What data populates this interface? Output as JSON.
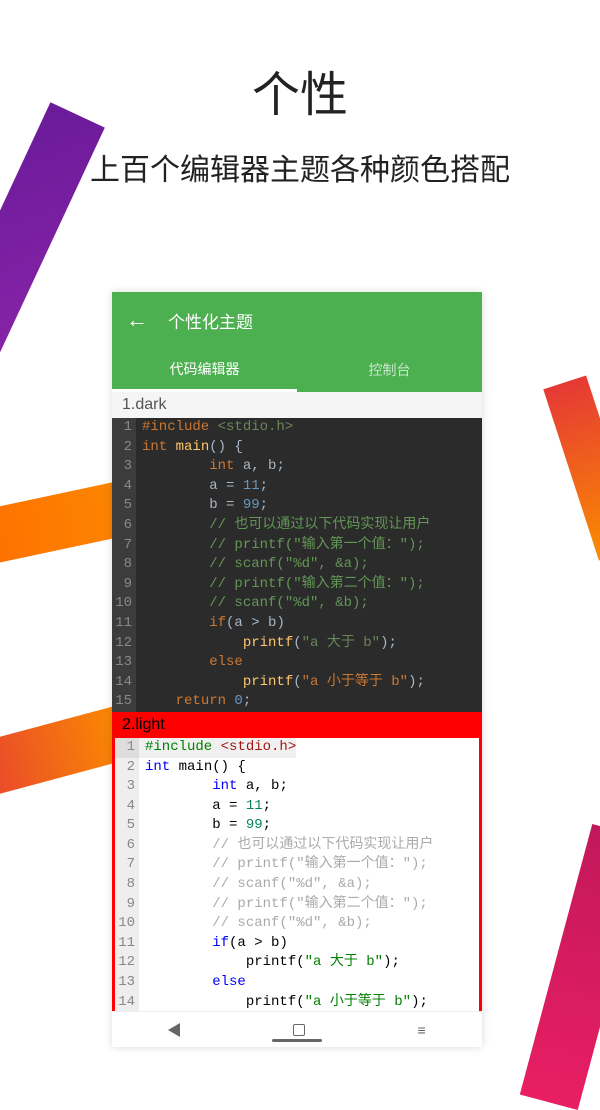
{
  "header": {
    "title": "个性",
    "subtitle": "上百个编辑器主题各种颜色搭配"
  },
  "app": {
    "title": "个性化主题",
    "tabs": [
      "代码编辑器",
      "控制台"
    ]
  },
  "themes": {
    "dark": {
      "label": "1.dark"
    },
    "light": {
      "label": "2.light"
    }
  },
  "code": {
    "l1": {
      "pre": "#include ",
      "inc": "<stdio.h>"
    },
    "l2": {
      "kw": "int ",
      "fn": "main",
      "rest": "() {"
    },
    "l3": {
      "kw": "int",
      "rest": " a, b;"
    },
    "l4": {
      "a": "        a = ",
      "num": "11",
      "b": ";"
    },
    "l5": {
      "a": "        b = ",
      "num": "99",
      "b": ";"
    },
    "l6": "        // 也可以通过以下代码实现让用户",
    "l7": "        // printf(\"输入第一个值：\");",
    "l8": "        // scanf(\"%d\", &a);",
    "l9": "        // printf(\"输入第二个值：\");",
    "l10": "        // scanf(\"%d\", &b);",
    "l11": {
      "kw": "if",
      "rest": "(a > b)"
    },
    "l12": {
      "fn": "printf",
      "a": "(",
      "str": "\"a 大于 b\"",
      "b": ");"
    },
    "l13": {
      "kw": "else"
    },
    "l14": {
      "fn": "printf",
      "a": "(",
      "str": "\"a 小于等于 b\"",
      "b": ");"
    },
    "l15": {
      "kw": "return ",
      "num": "0",
      "b": ";"
    }
  },
  "ln": {
    "n1": "1",
    "n2": "2",
    "n3": "3",
    "n4": "4",
    "n5": "5",
    "n6": "6",
    "n7": "7",
    "n8": "8",
    "n9": "9",
    "n10": "10",
    "n11": "11",
    "n12": "12",
    "n13": "13",
    "n14": "14",
    "n15": "15"
  }
}
